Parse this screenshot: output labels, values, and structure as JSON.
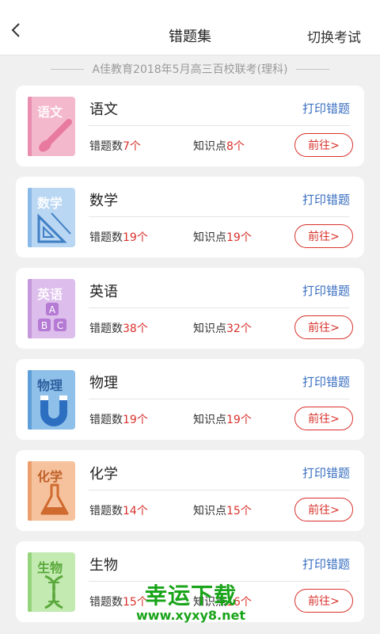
{
  "header": {
    "back_icon": "chevron-left-icon",
    "title": "错题集",
    "switch_label": "切换考试"
  },
  "exam_name": "A佳教育2018年5月高三百校联考(理科)",
  "labels": {
    "print": "打印错题",
    "go": "前往>",
    "errors_prefix": "错题数",
    "points_prefix": "知识点",
    "unit": "个"
  },
  "subjects": [
    {
      "name": "语文",
      "cover_text": "语文",
      "errors": "7",
      "points": "8",
      "cover_icon": "brush-icon",
      "colors": {
        "cover": "#f4b8cc",
        "spine": "#e98eae"
      }
    },
    {
      "name": "数学",
      "cover_text": "数学",
      "errors": "19",
      "points": "19",
      "cover_icon": "ruler-triangle-icon",
      "colors": {
        "cover": "#b9d6f3",
        "spine": "#8ab8e8"
      }
    },
    {
      "name": "英语",
      "cover_text": "英语",
      "errors": "38",
      "points": "32",
      "cover_icon": "abc-blocks-icon",
      "colors": {
        "cover": "#dcbdeb",
        "spine": "#c598dc"
      }
    },
    {
      "name": "物理",
      "cover_text": "物理",
      "errors": "19",
      "points": "19",
      "cover_icon": "magnet-icon",
      "colors": {
        "cover": "#8fc0ea",
        "spine": "#5f9fd9"
      }
    },
    {
      "name": "化学",
      "cover_text": "化学",
      "errors": "14",
      "points": "15",
      "cover_icon": "flask-icon",
      "colors": {
        "cover": "#f5c29d",
        "spine": "#eb9f6c"
      }
    },
    {
      "name": "生物",
      "cover_text": "生物",
      "errors": "15",
      "points": "16",
      "cover_icon": "dna-icon",
      "colors": {
        "cover": "#c3eab0",
        "spine": "#96d47c"
      }
    }
  ],
  "watermark": {
    "main": "幸运下载",
    "url": "www.xyxy8.net",
    "color": "#19a419"
  },
  "colors": {
    "accent_red": "#d8322c",
    "link_blue": "#3a6fc0",
    "background": "#f0f0f0"
  }
}
